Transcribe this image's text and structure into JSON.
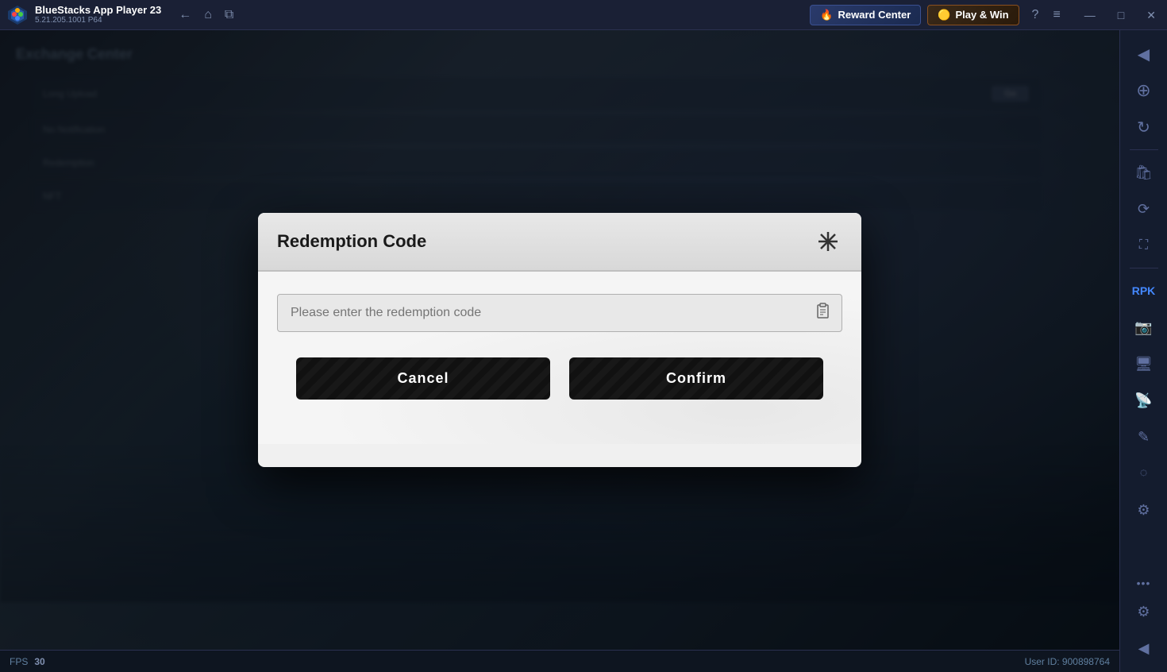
{
  "titlebar": {
    "app_name": "BlueStacks App Player 23",
    "app_version": "5.21.205.1001 P64",
    "back_label": "←",
    "home_label": "⌂",
    "pages_label": "⧉",
    "reward_center_label": "Reward Center",
    "play_win_label": "Play & Win",
    "help_label": "?",
    "menu_label": "≡",
    "minimize_label": "—",
    "maximize_label": "□",
    "close_label": "✕"
  },
  "sidebar": {
    "items": [
      {
        "id": "nav1",
        "icon": "◀",
        "name": "collapse-icon"
      },
      {
        "id": "nav2",
        "icon": "⊕",
        "name": "add-icon"
      },
      {
        "id": "nav3",
        "icon": "⟳",
        "name": "refresh-icon"
      },
      {
        "id": "nav4",
        "icon": "⚙",
        "name": "settings-icon"
      },
      {
        "id": "nav5",
        "icon": "📷",
        "name": "camera-icon"
      },
      {
        "id": "nav6",
        "icon": "⬜",
        "name": "screen-icon"
      },
      {
        "id": "nav7",
        "icon": "↻",
        "name": "rotate-icon"
      },
      {
        "id": "nav8",
        "icon": "⬛",
        "name": "display-icon"
      },
      {
        "id": "nav9",
        "icon": "✏",
        "name": "edit-icon"
      },
      {
        "id": "nav10",
        "icon": "⚙",
        "name": "gear-icon"
      },
      {
        "id": "dots",
        "icon": "⋮",
        "name": "more-icon"
      },
      {
        "id": "settings-main",
        "icon": "⚙",
        "name": "main-settings-icon"
      },
      {
        "id": "back",
        "icon": "◀",
        "name": "back-sidebar-icon"
      },
      {
        "id": "scroll",
        "icon": "◌",
        "name": "scroll-icon"
      }
    ],
    "dots_label": "•••"
  },
  "dialog": {
    "title": "Redemption Code",
    "close_label": "✕",
    "input_placeholder": "Please enter the redemption code",
    "input_value": "",
    "paste_icon": "📋",
    "cancel_label": "Cancel",
    "confirm_label": "Confirm"
  },
  "game": {
    "panel_title": "Exchange Center",
    "row1_label": "Long Upload",
    "row1_btn": "Go",
    "row2_label": "No Notification",
    "row3_label": "Redemption",
    "row4_label": "NFT"
  },
  "statusbar": {
    "fps_label": "FPS",
    "fps_value": "30",
    "user_id_label": "User ID: 900898764"
  }
}
